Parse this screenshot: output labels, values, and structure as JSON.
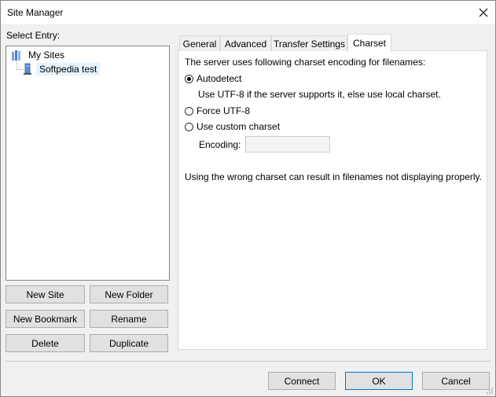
{
  "window": {
    "title": "Site Manager"
  },
  "left": {
    "select_label": "Select Entry:",
    "tree": [
      {
        "label": "My Sites"
      },
      {
        "label": "Softpedia test"
      }
    ],
    "buttons": {
      "new_site": "New Site",
      "new_folder": "New Folder",
      "new_bookmark": "New Bookmark",
      "rename": "Rename",
      "delete": "Delete",
      "duplicate": "Duplicate"
    }
  },
  "tabs": [
    {
      "label": "General"
    },
    {
      "label": "Advanced"
    },
    {
      "label": "Transfer Settings"
    },
    {
      "label": "Charset",
      "active": true
    }
  ],
  "charset": {
    "intro": "The server uses following charset encoding for filenames:",
    "autodetect": "Autodetect",
    "autodetect_desc": "Use UTF-8 if the server supports it, else use local charset.",
    "force_utf8": "Force UTF-8",
    "custom": "Use custom charset",
    "encoding_label": "Encoding:",
    "encoding_value": "",
    "warning": "Using the wrong charset can result in filenames not displaying properly.",
    "selected": "autodetect"
  },
  "footer": {
    "connect": "Connect",
    "ok": "OK",
    "cancel": "Cancel"
  }
}
